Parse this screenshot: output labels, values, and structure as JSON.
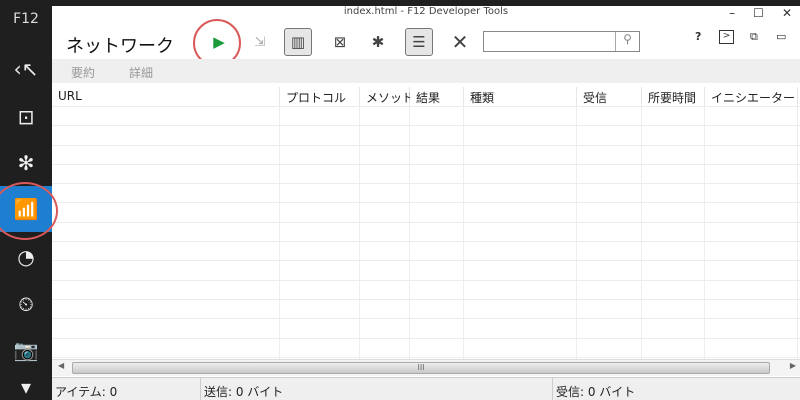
{
  "window": {
    "title": "index.html - F12 Developer Tools",
    "minimize": "–",
    "maximize": "☐",
    "close": "✕"
  },
  "sidebar": {
    "logo": "F12",
    "items": [
      {
        "name": "dom-explorer",
        "icon": "‹↖"
      },
      {
        "name": "console",
        "icon": "⊡"
      },
      {
        "name": "debugger",
        "icon": "✻"
      },
      {
        "name": "network",
        "icon": "📶",
        "selected": true
      },
      {
        "name": "performance",
        "icon": "◔"
      },
      {
        "name": "memory",
        "icon": "⏲"
      },
      {
        "name": "emulation",
        "icon": "📷"
      },
      {
        "name": "more",
        "icon": "▾"
      }
    ]
  },
  "toolbar": {
    "heading": "ネットワーク",
    "play": "▶",
    "save": "💾",
    "clear": "✕",
    "search_placeholder": "",
    "search_icon": "⚲",
    "help": "?",
    "accent": "#1a9a3a"
  },
  "subtabs": [
    "要約",
    "詳細"
  ],
  "columns": [
    "URL",
    "プロトコル",
    "メソッド",
    "結果",
    "種類",
    "受信",
    "所要時間",
    "イニシエーター"
  ],
  "status": {
    "items": "アイテム: 0",
    "sent": "送信: 0 バイト",
    "received": "受信: 0 バイト"
  }
}
